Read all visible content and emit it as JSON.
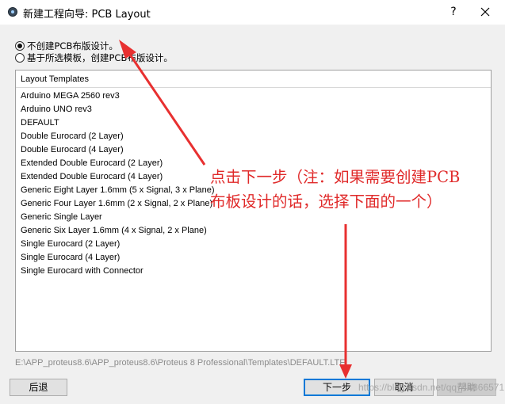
{
  "window": {
    "title": "新建工程向导: PCB Layout",
    "help_glyph": "?",
    "icon": "proteus-app-icon"
  },
  "options": [
    {
      "label": "不创建PCB布版设计。",
      "checked": true
    },
    {
      "label": "基于所选模板，创建PCB布版设计。",
      "checked": false
    }
  ],
  "templates": {
    "header": "Layout Templates",
    "items": [
      "Arduino MEGA 2560 rev3",
      "Arduino UNO rev3",
      "DEFAULT",
      "Double Eurocard (2 Layer)",
      "Double Eurocard (4 Layer)",
      "Extended Double Eurocard (2 Layer)",
      "Extended Double Eurocard (4 Layer)",
      "Generic Eight Layer 1.6mm (5 x Signal, 3 x Plane)",
      "Generic Four Layer 1.6mm (2 x Signal, 2 x Plane)",
      "Generic Single Layer",
      "Generic Six Layer 1.6mm (4 x Signal, 2 x Plane)",
      "Single Eurocard (2 Layer)",
      "Single Eurocard (4 Layer)",
      "Single Eurocard with Connector"
    ]
  },
  "path": "E:\\APP_proteus8.6\\APP_proteus8.6\\Proteus 8 Professional\\Templates\\DEFAULT.LTF",
  "buttons": {
    "back": "后退",
    "next": "下一步",
    "cancel": "取消",
    "help": "帮助"
  },
  "annotation": {
    "line1": "点击下一步（注：如果需要创建PCB",
    "line2": "布板设计的话，选择下面的一个）",
    "color": "#e02a2a"
  },
  "watermark": "https://blog.csdn.net/qq_44866571"
}
